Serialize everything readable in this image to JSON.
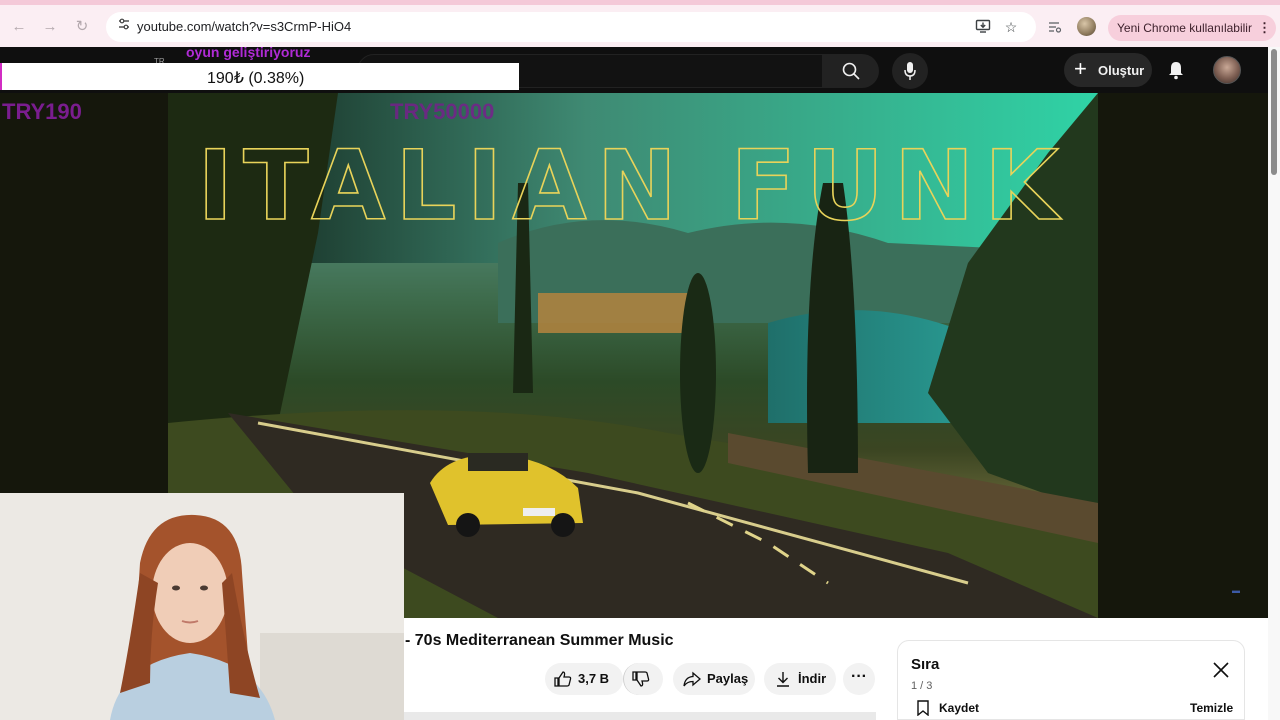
{
  "browser": {
    "url": "youtube.com/watch?v=s3CrmP-HiO4",
    "update_label": "Yeni Chrome kullanılabilir",
    "icons": [
      "back-icon",
      "forward-icon",
      "reload-icon",
      "site-info-icon",
      "install-app-icon",
      "bookmark-star-icon",
      "tab-search-icon",
      "profile-icon",
      "kebab-menu-icon"
    ]
  },
  "masthead": {
    "create_label": "Oluştur",
    "icons": [
      "search-icon",
      "microphone-icon",
      "plus-icon",
      "bell-icon",
      "avatar"
    ]
  },
  "stream_overlay": {
    "tag": "TR",
    "note": "oyun geliştiriyoruz",
    "goal_text": "190₺ (0.38%)",
    "goal_progress_percent": 0.38,
    "left_amount": "TRY190",
    "right_amount": "TRY50000"
  },
  "video": {
    "thumbnail_title": "ITALIAN FUNK",
    "title": "- 70s Mediterranean Summer Music"
  },
  "actions": {
    "like_count": "3,7 B",
    "share_label": "Paylaş",
    "download_label": "İndir",
    "more_label": "···"
  },
  "queue": {
    "title": "Sıra",
    "count": "1 / 3",
    "save_label": "Kaydet",
    "clear_label": "Temizle"
  },
  "colors": {
    "chrome_bar": "#fbeef3",
    "update_pill": "#f7cfdc",
    "masthead": "#0f0f0f",
    "overlay_purple": "#7a1d8f",
    "thumbnail_title": "#e8d35a"
  }
}
